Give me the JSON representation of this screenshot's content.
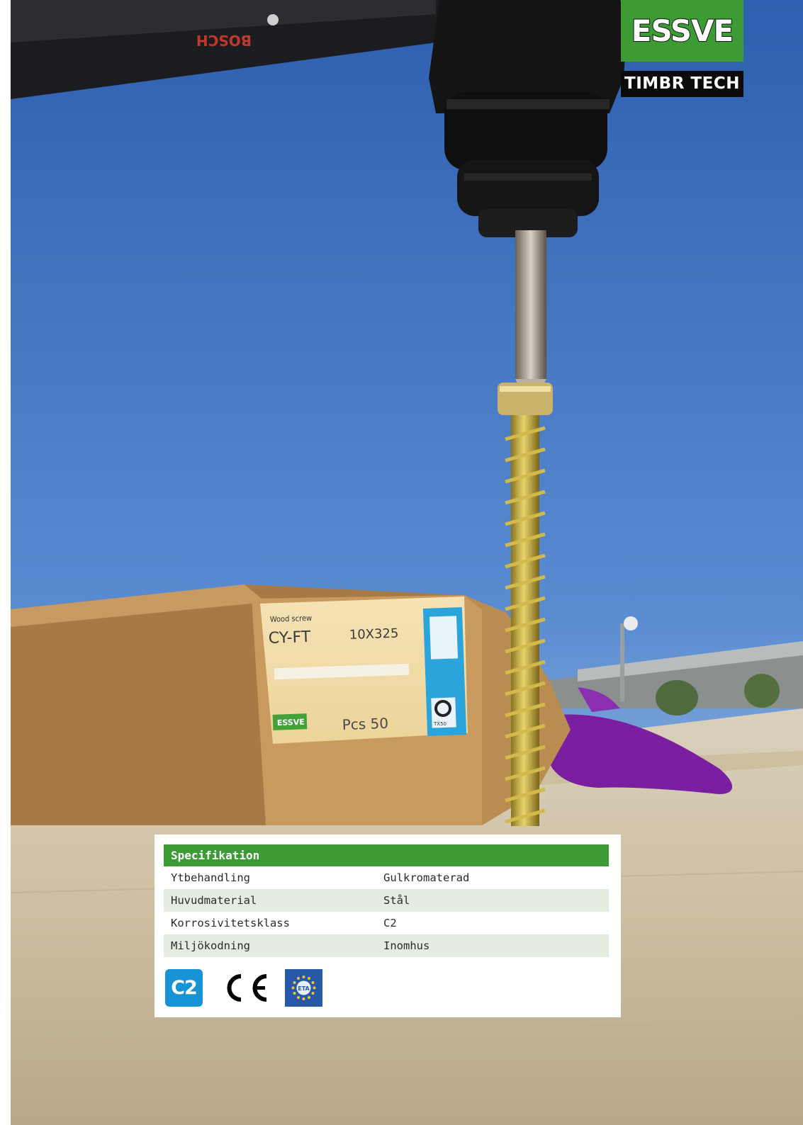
{
  "brand": {
    "logo_text": "ESSVE",
    "subtitle": "TIMBR TECH"
  },
  "photo": {
    "box_label_type": "Wood screw",
    "box_label_product": "CY-FT",
    "box_label_size": "10X325",
    "box_label_brand": "ESSVE",
    "box_label_pcs": "Pcs 50",
    "box_label_drive": "TX50",
    "drill_brand": "BOSCH"
  },
  "spec": {
    "header": "Specifikation",
    "rows": [
      {
        "label": "Ytbehandling",
        "value": "Gulkromaterad"
      },
      {
        "label": "Huvudmaterial",
        "value": "Stål"
      },
      {
        "label": "Korrosivitetsklass",
        "value": "C2"
      },
      {
        "label": "Miljökodning",
        "value": "Inomhus"
      }
    ]
  },
  "certifications": {
    "c2_label": "C2",
    "ce_mark": "CE",
    "eta_label": "ETA"
  },
  "colors": {
    "brand_green": "#3d9b35",
    "row_alt": "#e6ecdf",
    "c2_blue": "#1794d6",
    "eta_blue": "#2859a8"
  }
}
